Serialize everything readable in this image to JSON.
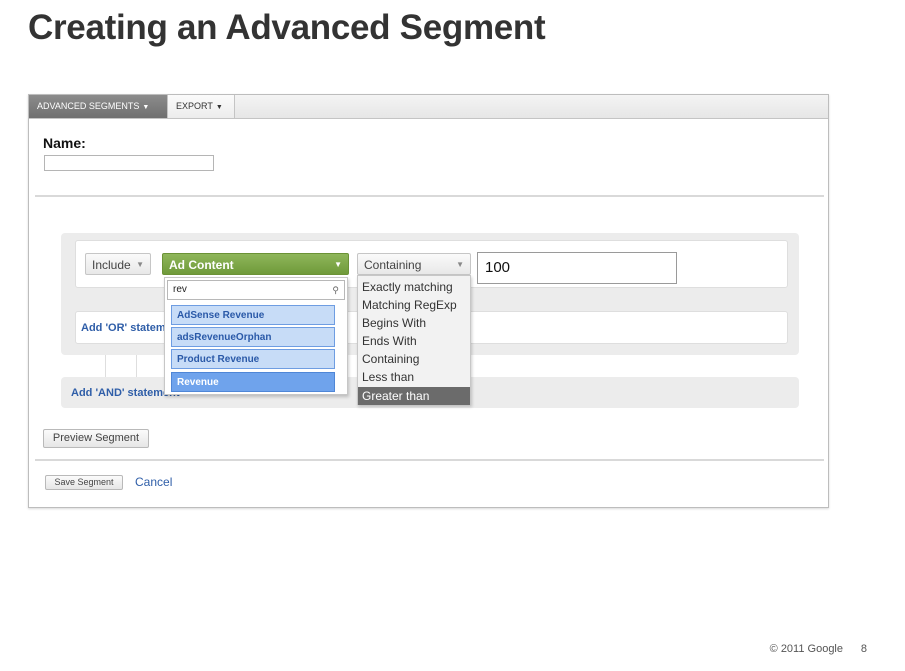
{
  "slide": {
    "title": "Creating an Advanced Segment",
    "copyright": "© 2011 Google",
    "page_number": "8"
  },
  "toolbar": {
    "advanced_segments": "ADVANCED SEGMENTS",
    "export": "EXPORT"
  },
  "form": {
    "name_label": "Name:",
    "name_value": ""
  },
  "condition": {
    "include": "Include",
    "field": "Ad Content",
    "match_type": "Containing",
    "value": "100",
    "add_or": "Add 'OR' statement",
    "add_and": "Add 'AND' statement"
  },
  "field_dropdown": {
    "search_value": "rev",
    "options": [
      "AdSense Revenue",
      "adsRevenueOrphan",
      "Product Revenue",
      "Revenue"
    ],
    "highlighted": "Revenue"
  },
  "match_dropdown": {
    "options": [
      "Exactly matching",
      "Matching RegExp",
      "Begins With",
      "Ends With",
      "Containing",
      "Less than",
      "Greater than"
    ],
    "highlighted": "Greater than"
  },
  "actions": {
    "preview": "Preview Segment",
    "save": "Save Segment",
    "cancel": "Cancel"
  }
}
